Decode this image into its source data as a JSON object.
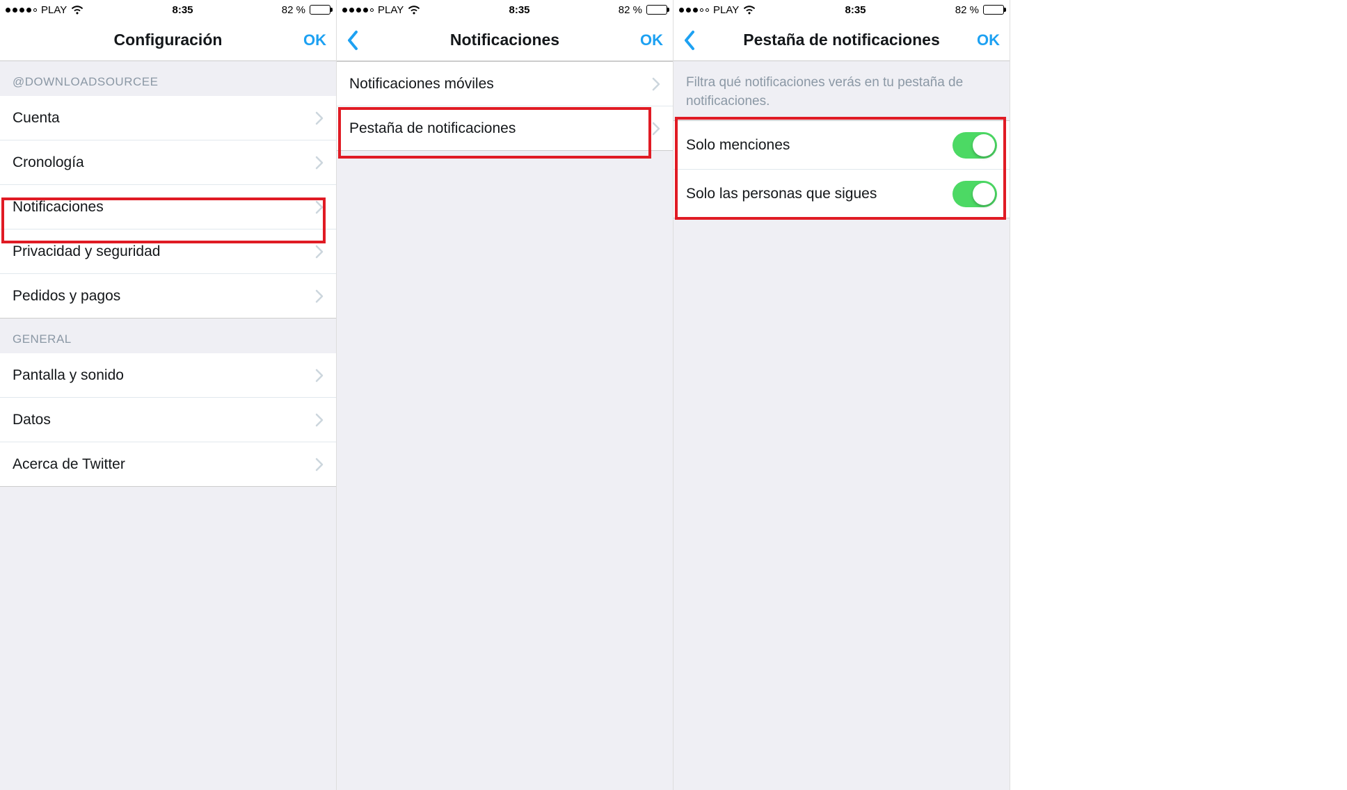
{
  "status": {
    "carrier": "PLAY",
    "time": "8:35",
    "battery_pct": "82 %",
    "signal_filled_1": 4,
    "signal_filled_3": 3
  },
  "screen1": {
    "title": "Configuración",
    "ok": "OK",
    "section_user": "@DOWNLOADSOURCEE",
    "rows_user": [
      {
        "label": "Cuenta"
      },
      {
        "label": "Cronología"
      },
      {
        "label": "Notificaciones"
      },
      {
        "label": "Privacidad y seguridad"
      },
      {
        "label": "Pedidos y pagos"
      }
    ],
    "section_general": "GENERAL",
    "rows_general": [
      {
        "label": "Pantalla y sonido"
      },
      {
        "label": "Datos"
      },
      {
        "label": "Acerca de Twitter"
      }
    ]
  },
  "screen2": {
    "title": "Notificaciones",
    "ok": "OK",
    "rows": [
      {
        "label": "Notificaciones móviles"
      },
      {
        "label": "Pestaña de notificaciones"
      }
    ]
  },
  "screen3": {
    "title": "Pestaña de notificaciones",
    "ok": "OK",
    "info": "Filtra qué notificaciones verás en tu pestaña de notificaciones.",
    "toggles": [
      {
        "label": "Solo menciones",
        "on": true
      },
      {
        "label": "Solo las personas que sigues",
        "on": true
      }
    ]
  }
}
